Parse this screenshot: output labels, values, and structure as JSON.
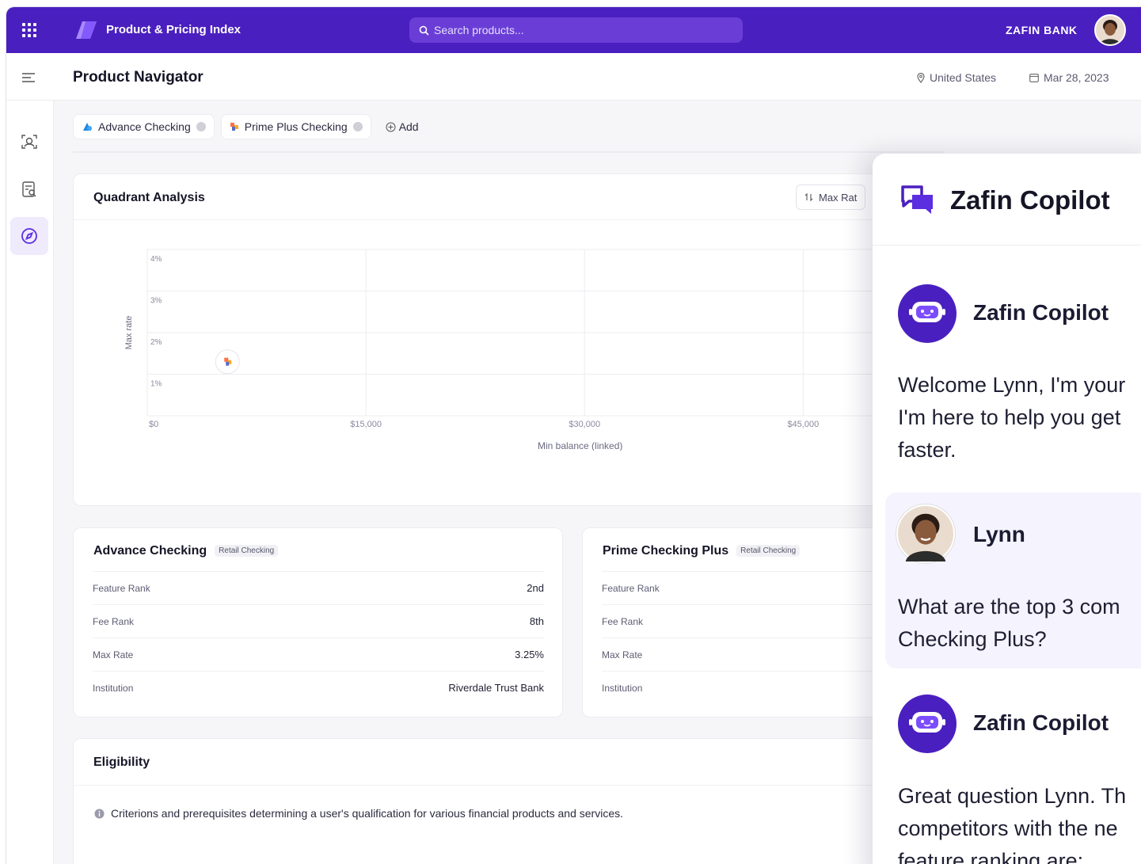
{
  "app": {
    "title": "Product & Pricing Index",
    "search_placeholder": "Search products...",
    "bank": "ZAFIN BANK"
  },
  "header": {
    "page_title": "Product Navigator",
    "location": "United States",
    "date": "Mar 28, 2023"
  },
  "chips": [
    {
      "label": "Advance Checking"
    },
    {
      "label": "Prime Plus Checking"
    }
  ],
  "add_label": "Add",
  "quadrant": {
    "title": "Quadrant Analysis",
    "sort_label": "Max Rat"
  },
  "chart_data": {
    "type": "scatter",
    "xlabel": "Min balance (linked)",
    "ylabel": "Max rate",
    "x_ticks": [
      "$0",
      "$15,000",
      "$30,000",
      "$45,000"
    ],
    "y_ticks": [
      "1%",
      "2%",
      "3%",
      "4%"
    ],
    "xlim": [
      0,
      54000
    ],
    "ylim": [
      0,
      4
    ],
    "grid": true,
    "points": [
      {
        "x": 5500,
        "y": 1.3
      }
    ]
  },
  "products": [
    {
      "name": "Advance Checking",
      "tag": "Retail Checking",
      "rows": [
        {
          "label": "Feature Rank",
          "value": "2nd"
        },
        {
          "label": "Fee Rank",
          "value": "8th"
        },
        {
          "label": "Max Rate",
          "value": "3.25%"
        },
        {
          "label": "Institution",
          "value": "Riverdale Trust Bank"
        }
      ]
    },
    {
      "name": "Prime Checking Plus",
      "tag": "Retail Checking",
      "rows": [
        {
          "label": "Feature Rank",
          "value": ""
        },
        {
          "label": "Fee Rank",
          "value": ""
        },
        {
          "label": "Max Rate",
          "value": ""
        },
        {
          "label": "Institution",
          "value": ""
        }
      ]
    }
  ],
  "eligibility": {
    "title": "Eligibility",
    "description": "Criterions and prerequisites determining a user's qualification for various financial products and services."
  },
  "copilot": {
    "title": "Zafin Copilot",
    "messages": [
      {
        "sender": "Zafin Copilot",
        "lines": [
          "Welcome Lynn, I'm your",
          "I'm here to help you get",
          "faster."
        ]
      },
      {
        "sender": "Lynn",
        "lines": [
          "What are the top 3 com",
          "Checking Plus?"
        ]
      },
      {
        "sender": "Zafin Copilot",
        "lines": [
          "Great question Lynn. Th",
          "competitors with the ne",
          "feature ranking are:"
        ]
      }
    ]
  },
  "colors": {
    "brand": "#4a1fbf",
    "accent_light": "#efeafc"
  }
}
